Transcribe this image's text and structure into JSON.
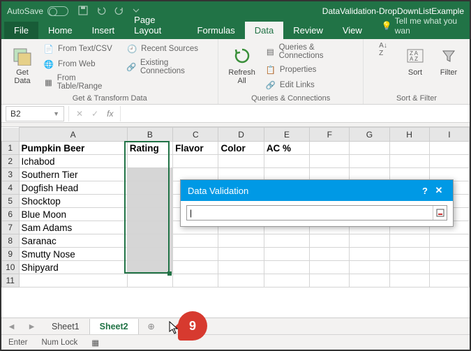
{
  "titlebar": {
    "autosave_label": "AutoSave",
    "autosave_state": "On",
    "doc_title": "DataValidation-DropDownListExample"
  },
  "tabs": {
    "file": "File",
    "list": [
      "Home",
      "Insert",
      "Page Layout",
      "Formulas",
      "Data",
      "Review",
      "View"
    ],
    "active": "Data",
    "tellme": "Tell me what you wan"
  },
  "ribbon": {
    "get_data": "Get\nData",
    "from_text_csv": "From Text/CSV",
    "from_web": "From Web",
    "from_table": "From Table/Range",
    "recent_sources": "Recent Sources",
    "existing_conn": "Existing Connections",
    "group1_label": "Get & Transform Data",
    "refresh_all": "Refresh\nAll",
    "queries_conn": "Queries & Connections",
    "properties": "Properties",
    "edit_links": "Edit Links",
    "group2_label": "Queries & Connections",
    "sort": "Sort",
    "filter": "Filter",
    "group3_label": "Sort & Filter"
  },
  "namebox": "B2",
  "fx_label": "fx",
  "headers": [
    "A",
    "B",
    "C",
    "D",
    "E",
    "F",
    "G",
    "H",
    "I"
  ],
  "row1": {
    "A": "Pumpkin Beer",
    "B": "Rating",
    "C": "Flavor",
    "D": "Color",
    "E": "AC %"
  },
  "colA": [
    "Ichabod",
    "Southern Tier",
    "Dogfish Head",
    "Shocktop",
    "Blue Moon",
    "Sam Adams",
    "Saranac",
    "Smutty Nose",
    "Shipyard"
  ],
  "dialog": {
    "title": "Data Validation",
    "value": "|"
  },
  "sheets": {
    "s1": "Sheet1",
    "s2": "Sheet2"
  },
  "status": {
    "mode": "Enter",
    "numlock": "Num Lock"
  },
  "badge": "9"
}
